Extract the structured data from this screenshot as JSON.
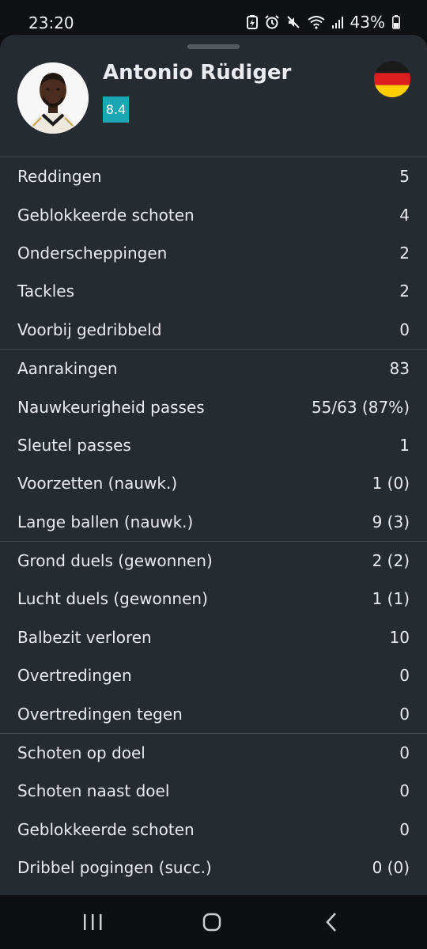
{
  "status_bar": {
    "time": "23:20",
    "battery_percent": "43%",
    "icons": [
      "battery-saver-icon",
      "alarm-icon",
      "mute-icon",
      "wifi-icon",
      "signal-icon",
      "battery-icon"
    ]
  },
  "player": {
    "name": "Antonio Rüdiger",
    "rating": "8.4",
    "rating_color": "#1aa6b3",
    "nationality_flag": "germany-flag-icon"
  },
  "stat_groups": [
    {
      "rows": [
        {
          "label": "Reddingen",
          "value": "5"
        },
        {
          "label": "Geblokkeerde schoten",
          "value": "4"
        },
        {
          "label": "Onderscheppingen",
          "value": "2"
        },
        {
          "label": "Tackles",
          "value": "2"
        },
        {
          "label": "Voorbij gedribbeld",
          "value": "0"
        }
      ]
    },
    {
      "rows": [
        {
          "label": "Aanrakingen",
          "value": "83"
        },
        {
          "label": "Nauwkeurigheid passes",
          "value": "55/63 (87%)"
        },
        {
          "label": "Sleutel passes",
          "value": "1"
        },
        {
          "label": "Voorzetten (nauwk.)",
          "value": "1 (0)"
        },
        {
          "label": "Lange ballen (nauwk.)",
          "value": "9 (3)"
        }
      ]
    },
    {
      "rows": [
        {
          "label": "Grond duels (gewonnen)",
          "value": "2 (2)"
        },
        {
          "label": "Lucht duels (gewonnen)",
          "value": "1 (1)"
        },
        {
          "label": "Balbezit verloren",
          "value": "10"
        },
        {
          "label": "Overtredingen",
          "value": "0"
        },
        {
          "label": "Overtredingen tegen",
          "value": "0"
        }
      ]
    },
    {
      "rows": [
        {
          "label": "Schoten op doel",
          "value": "0"
        },
        {
          "label": "Schoten naast doel",
          "value": "0"
        },
        {
          "label": "Geblokkeerde schoten",
          "value": "0"
        },
        {
          "label": "Dribbel pogingen (succ.)",
          "value": "0 (0)"
        }
      ]
    }
  ],
  "nav_bar": {
    "buttons": [
      "recent-apps-icon",
      "home-icon",
      "back-icon"
    ]
  }
}
